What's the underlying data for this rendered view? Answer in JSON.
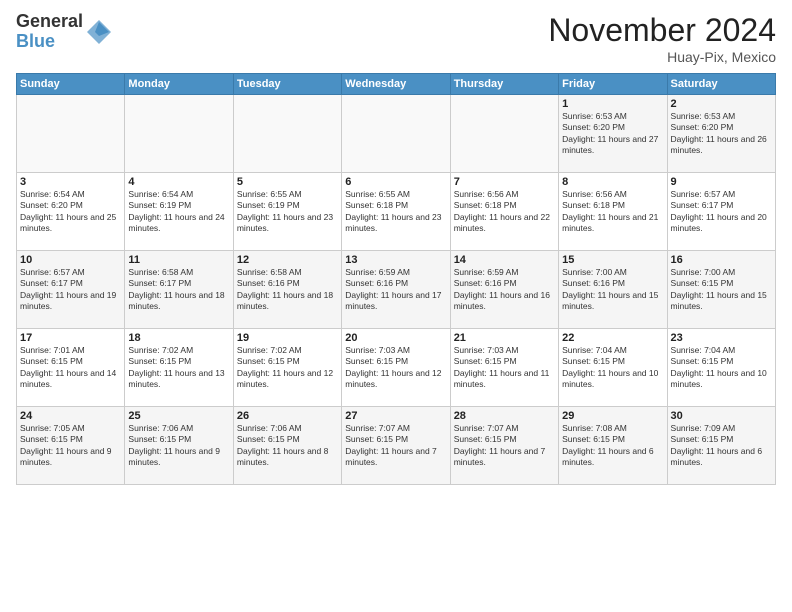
{
  "logo": {
    "general": "General",
    "blue": "Blue"
  },
  "header": {
    "month": "November 2024",
    "location": "Huay-Pix, Mexico"
  },
  "weekdays": [
    "Sunday",
    "Monday",
    "Tuesday",
    "Wednesday",
    "Thursday",
    "Friday",
    "Saturday"
  ],
  "weeks": [
    [
      {
        "day": "",
        "info": ""
      },
      {
        "day": "",
        "info": ""
      },
      {
        "day": "",
        "info": ""
      },
      {
        "day": "",
        "info": ""
      },
      {
        "day": "",
        "info": ""
      },
      {
        "day": "1",
        "info": "Sunrise: 6:53 AM\nSunset: 6:20 PM\nDaylight: 11 hours and 27 minutes."
      },
      {
        "day": "2",
        "info": "Sunrise: 6:53 AM\nSunset: 6:20 PM\nDaylight: 11 hours and 26 minutes."
      }
    ],
    [
      {
        "day": "3",
        "info": "Sunrise: 6:54 AM\nSunset: 6:20 PM\nDaylight: 11 hours and 25 minutes."
      },
      {
        "day": "4",
        "info": "Sunrise: 6:54 AM\nSunset: 6:19 PM\nDaylight: 11 hours and 24 minutes."
      },
      {
        "day": "5",
        "info": "Sunrise: 6:55 AM\nSunset: 6:19 PM\nDaylight: 11 hours and 23 minutes."
      },
      {
        "day": "6",
        "info": "Sunrise: 6:55 AM\nSunset: 6:18 PM\nDaylight: 11 hours and 23 minutes."
      },
      {
        "day": "7",
        "info": "Sunrise: 6:56 AM\nSunset: 6:18 PM\nDaylight: 11 hours and 22 minutes."
      },
      {
        "day": "8",
        "info": "Sunrise: 6:56 AM\nSunset: 6:18 PM\nDaylight: 11 hours and 21 minutes."
      },
      {
        "day": "9",
        "info": "Sunrise: 6:57 AM\nSunset: 6:17 PM\nDaylight: 11 hours and 20 minutes."
      }
    ],
    [
      {
        "day": "10",
        "info": "Sunrise: 6:57 AM\nSunset: 6:17 PM\nDaylight: 11 hours and 19 minutes."
      },
      {
        "day": "11",
        "info": "Sunrise: 6:58 AM\nSunset: 6:17 PM\nDaylight: 11 hours and 18 minutes."
      },
      {
        "day": "12",
        "info": "Sunrise: 6:58 AM\nSunset: 6:16 PM\nDaylight: 11 hours and 18 minutes."
      },
      {
        "day": "13",
        "info": "Sunrise: 6:59 AM\nSunset: 6:16 PM\nDaylight: 11 hours and 17 minutes."
      },
      {
        "day": "14",
        "info": "Sunrise: 6:59 AM\nSunset: 6:16 PM\nDaylight: 11 hours and 16 minutes."
      },
      {
        "day": "15",
        "info": "Sunrise: 7:00 AM\nSunset: 6:16 PM\nDaylight: 11 hours and 15 minutes."
      },
      {
        "day": "16",
        "info": "Sunrise: 7:00 AM\nSunset: 6:15 PM\nDaylight: 11 hours and 15 minutes."
      }
    ],
    [
      {
        "day": "17",
        "info": "Sunrise: 7:01 AM\nSunset: 6:15 PM\nDaylight: 11 hours and 14 minutes."
      },
      {
        "day": "18",
        "info": "Sunrise: 7:02 AM\nSunset: 6:15 PM\nDaylight: 11 hours and 13 minutes."
      },
      {
        "day": "19",
        "info": "Sunrise: 7:02 AM\nSunset: 6:15 PM\nDaylight: 11 hours and 12 minutes."
      },
      {
        "day": "20",
        "info": "Sunrise: 7:03 AM\nSunset: 6:15 PM\nDaylight: 11 hours and 12 minutes."
      },
      {
        "day": "21",
        "info": "Sunrise: 7:03 AM\nSunset: 6:15 PM\nDaylight: 11 hours and 11 minutes."
      },
      {
        "day": "22",
        "info": "Sunrise: 7:04 AM\nSunset: 6:15 PM\nDaylight: 11 hours and 10 minutes."
      },
      {
        "day": "23",
        "info": "Sunrise: 7:04 AM\nSunset: 6:15 PM\nDaylight: 11 hours and 10 minutes."
      }
    ],
    [
      {
        "day": "24",
        "info": "Sunrise: 7:05 AM\nSunset: 6:15 PM\nDaylight: 11 hours and 9 minutes."
      },
      {
        "day": "25",
        "info": "Sunrise: 7:06 AM\nSunset: 6:15 PM\nDaylight: 11 hours and 9 minutes."
      },
      {
        "day": "26",
        "info": "Sunrise: 7:06 AM\nSunset: 6:15 PM\nDaylight: 11 hours and 8 minutes."
      },
      {
        "day": "27",
        "info": "Sunrise: 7:07 AM\nSunset: 6:15 PM\nDaylight: 11 hours and 7 minutes."
      },
      {
        "day": "28",
        "info": "Sunrise: 7:07 AM\nSunset: 6:15 PM\nDaylight: 11 hours and 7 minutes."
      },
      {
        "day": "29",
        "info": "Sunrise: 7:08 AM\nSunset: 6:15 PM\nDaylight: 11 hours and 6 minutes."
      },
      {
        "day": "30",
        "info": "Sunrise: 7:09 AM\nSunset: 6:15 PM\nDaylight: 11 hours and 6 minutes."
      }
    ]
  ]
}
